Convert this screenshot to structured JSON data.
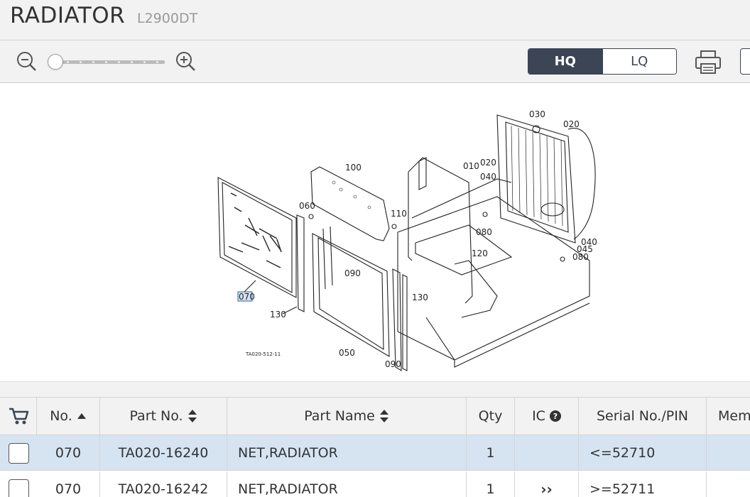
{
  "header": {
    "title": "RADIATOR",
    "model": "L2900DT"
  },
  "toolbar": {
    "zoom_out_icon": "zoom-out-icon",
    "zoom_in_icon": "zoom-in-icon",
    "zoom_level": 0,
    "quality": {
      "hq_label": "HQ",
      "lq_label": "LQ",
      "selected": "HQ"
    },
    "print_icon": "printer-icon"
  },
  "diagram": {
    "selected_callout": "070",
    "figure_code": "TA020-512-11",
    "callouts": [
      "030",
      "020",
      "100",
      "010",
      "020",
      "040",
      "060",
      "110",
      "080",
      "090",
      "120",
      "040",
      "045",
      "080",
      "070",
      "130",
      "130",
      "050",
      "090"
    ]
  },
  "table": {
    "headers": {
      "cart_icon": "cart-icon",
      "no": "No.",
      "part_no": "Part No.",
      "part_name": "Part Name",
      "qty": "Qty",
      "ic": "IC",
      "serial": "Serial No./PIN",
      "memo": "Memo"
    },
    "rows": [
      {
        "no": "070",
        "part_no": "TA020-16240",
        "part_name": "NET,RADIATOR",
        "qty": "1",
        "ic": "",
        "serial": "<=52710",
        "selected": true
      },
      {
        "no": "070",
        "part_no": "TA020-16242",
        "part_name": "NET,RADIATOR",
        "qty": "1",
        "ic": "›› ",
        "serial": ">=52711",
        "selected": false
      }
    ]
  },
  "colors": {
    "accent": "#3b4555",
    "selected_row": "#d6e4f2",
    "header_bg": "#f2f2f2"
  }
}
